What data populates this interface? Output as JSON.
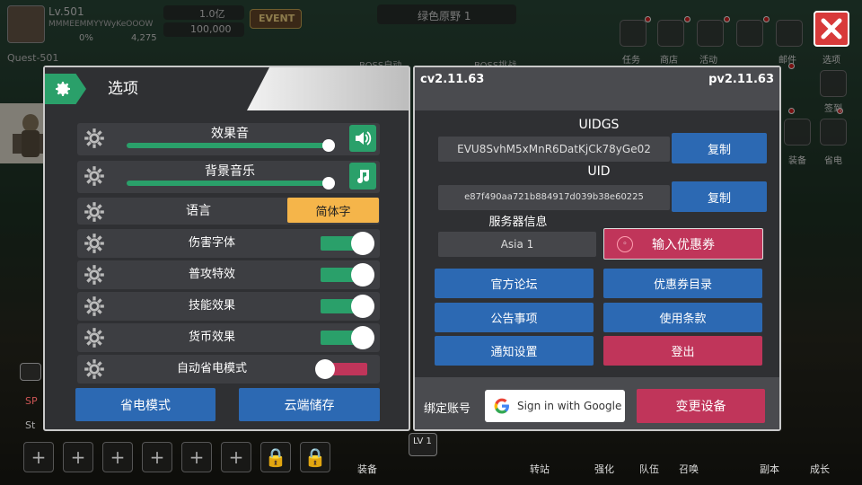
{
  "hud": {
    "level": "Lv.501",
    "player_name": "MMMEEMMYYWyKeOOOW",
    "stat_left": "0%",
    "stat_right": "4,275",
    "gem_count": "1.0亿",
    "gold_count": "100,000",
    "event_label": "EVENT",
    "stage_name": "绿色原野 1",
    "quest_label": "Quest-501",
    "boss_labels": [
      "BOSS自动",
      "BOSS挑战"
    ],
    "top_labels": [
      "任务",
      "商店",
      "活动",
      "邮件",
      "选项"
    ],
    "side_labels": [
      "签到",
      "装备",
      "省电"
    ],
    "bottom_labels": [
      "装备",
      "转站",
      "强化",
      "队伍",
      "召唤",
      "副本",
      "成长"
    ],
    "level_badge": "LV 1",
    "side_text": [
      "SP",
      "St"
    ]
  },
  "settings": {
    "title": "选项",
    "sound_effects": {
      "label": "效果音",
      "level": 1.0
    },
    "bgm": {
      "label": "背景音乐",
      "level": 1.0
    },
    "language": {
      "label": "语言",
      "value": "简体字"
    },
    "toggles": [
      {
        "label": "伤害字体",
        "on": true
      },
      {
        "label": "普攻特效",
        "on": true
      },
      {
        "label": "技能效果",
        "on": true
      },
      {
        "label": "货币效果",
        "on": true
      },
      {
        "label": "自动省电模式",
        "on": false
      }
    ],
    "power_save_button": "省电模式",
    "cloud_save_button": "云端储存"
  },
  "account": {
    "client_version": "cv2.11.63",
    "patch_version": "pv2.11.63",
    "uidgs_label": "UIDGS",
    "uidgs_value": "EVU8SvhM5xMnR6DatKjCk78yGe02",
    "uid_label": "UID",
    "uid_value": "e87f490aa721b884917d039b38e60225",
    "copy_label_1": "复制",
    "copy_label_2": "复制",
    "server_label": "服务器信息",
    "server_value": "Asia 1",
    "coupon_button": "输入优惠券",
    "forum_button": "官方论坛",
    "coupon_list_button": "优惠券目录",
    "notice_button": "公告事项",
    "terms_button": "使用条款",
    "notify_button": "通知设置",
    "logout_button": "登出",
    "bind_label": "绑定账号",
    "google_button": "Sign in with Google",
    "change_device_button": "变更设备"
  },
  "colors": {
    "accent_green": "#2aa06a",
    "button_blue": "#2c69b3",
    "button_red": "#c0355a",
    "language_orange": "#f5b54a",
    "close_red": "#d83a3a"
  },
  "icons": {
    "close": "close-icon",
    "settings": "gear-icon",
    "speaker": "speaker-icon",
    "music": "music-note-icon",
    "google": "google-g-icon"
  }
}
